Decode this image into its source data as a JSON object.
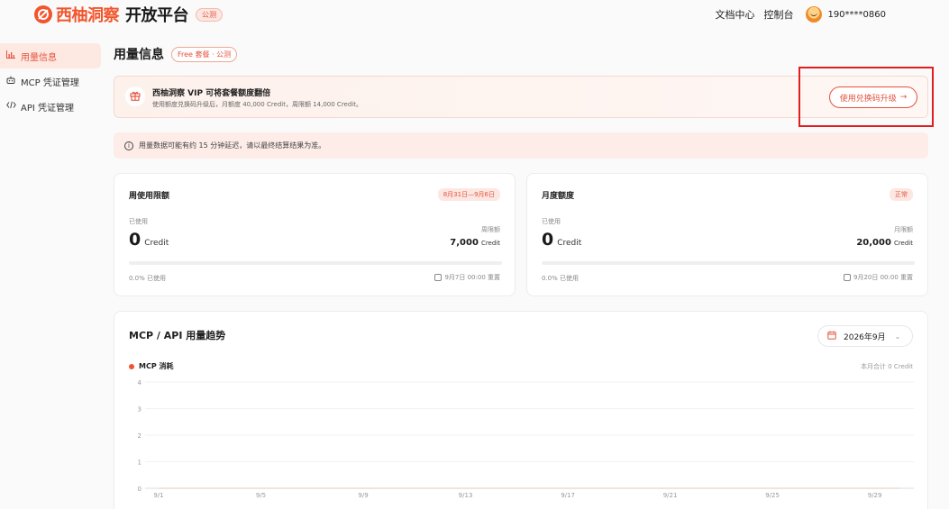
{
  "header": {
    "brand": "西柚洞察",
    "brand_sub": "开放平台",
    "beta_badge": "公测",
    "nav": [
      "文档中心",
      "控制台"
    ],
    "phone": "190****0860"
  },
  "sidebar": {
    "items": [
      {
        "label": "用量信息",
        "icon": "bar-chart-icon",
        "active": true
      },
      {
        "label": "MCP 凭证管理",
        "icon": "robot-icon",
        "active": false
      },
      {
        "label": "API 凭证管理",
        "icon": "code-icon",
        "active": false
      }
    ]
  },
  "main": {
    "title": "用量信息",
    "plan_badge": "Free 套餐 · 公测",
    "vip": {
      "title": "西柚洞察 VIP 可将套餐额度翻倍",
      "desc": "使用额度兑换码升级后，月额度 40,000 Credit，周限额 14,000 Credit。",
      "button": "使用兑换码升级",
      "button_arrow": "→"
    },
    "notice": "用量数据可能有约 15 分钟延迟，请以最终结算结果为准。",
    "weekly": {
      "title": "周使用限额",
      "badge": "8月31日—9月6日",
      "used_label": "已使用",
      "used_value": "0",
      "unit": "Credit",
      "limit_label": "周限额",
      "limit_value": "7,000",
      "progress": 0.0,
      "pct_text": "0.0% 已使用",
      "reset": "9月7日 00:00 重置"
    },
    "monthly": {
      "title": "月度额度",
      "badge": "正常",
      "used_label": "已使用",
      "used_value": "0",
      "unit": "Credit",
      "limit_label": "月限额",
      "limit_value": "20,000",
      "progress": 0.0,
      "pct_text": "0.0% 已使用",
      "reset": "9月20日 00:00 重置"
    },
    "trend": {
      "title": "MCP / API 用量趋势",
      "month": "2026年9月",
      "legend": "MCP 消耗",
      "total": "本月合计 0 Credit"
    }
  },
  "colors": {
    "accent": "#e5533f",
    "series": "#f05232",
    "highlight": "#e11d1d"
  },
  "chart_data": {
    "type": "line",
    "x": [
      "9/1",
      "9/2",
      "9/3",
      "9/4",
      "9/5",
      "9/6",
      "9/7",
      "9/8",
      "9/9",
      "9/10",
      "9/11",
      "9/12",
      "9/13",
      "9/14",
      "9/15",
      "9/16",
      "9/17",
      "9/18",
      "9/19",
      "9/20",
      "9/21",
      "9/22",
      "9/23",
      "9/24",
      "9/25",
      "9/26",
      "9/27",
      "9/28",
      "9/29",
      "9/30"
    ],
    "x_tick_labels": [
      "9/1",
      "9/5",
      "9/9",
      "9/13",
      "9/17",
      "9/21",
      "9/25",
      "9/29"
    ],
    "series": [
      {
        "name": "MCP 消耗",
        "values": [
          0,
          0,
          0,
          0,
          0,
          0,
          0,
          0,
          0,
          0,
          0,
          0,
          0,
          0,
          0,
          0,
          0,
          0,
          0,
          0,
          0,
          0,
          0,
          0,
          0,
          0,
          0,
          0,
          0,
          0
        ]
      }
    ],
    "ylim": [
      0,
      4
    ],
    "yticks": [
      0,
      1,
      2,
      3,
      4
    ],
    "grid": true,
    "xlabel": "",
    "ylabel": ""
  }
}
